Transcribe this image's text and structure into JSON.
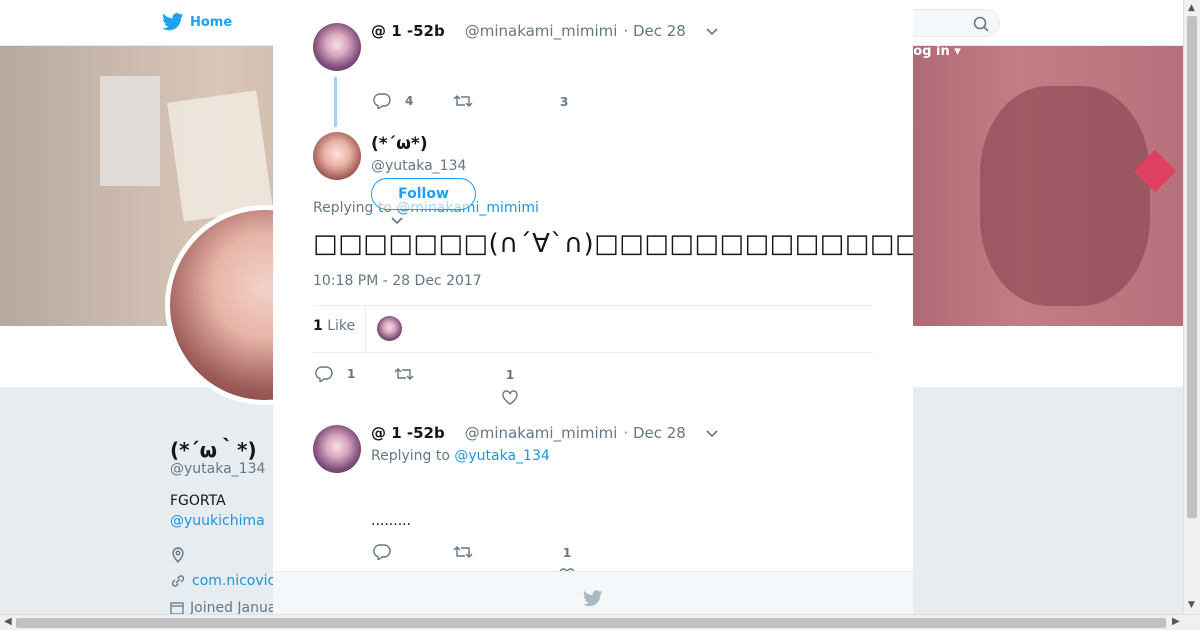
{
  "nav": {
    "home_label": "Home",
    "login_label": "Log in ▾"
  },
  "profile": {
    "name": "(*´ω｀*)",
    "handle": "@yutaka_134",
    "bio": "FGORTA",
    "bio_link": "@yuukichima",
    "url": "com.nicovic",
    "joined": "Joined Janua"
  },
  "tweet1": {
    "name": "@ 1 -52b",
    "handle": "@minakami_mimimi",
    "date": "· Dec 28",
    "replies": "4",
    "likes": "3"
  },
  "main_tweet": {
    "name": "(*´ω*)",
    "handle": "@yutaka_134",
    "follow_label": "Follow",
    "replying_prefix": "Replying to",
    "replying_to": "@minakami_mimimi",
    "text": "□□□□□□□(∩´∀`∩)□□□□□□□□□□□□□□□□□□□□□□□□□□□□□□□□□□□□□□□□□",
    "timestamp": "10:18 PM - 28 Dec 2017",
    "like_count": "1",
    "like_label": "Like",
    "replies": "1",
    "likes": "1"
  },
  "tweet3": {
    "name": "@ 1 -52b",
    "handle": "@minakami_mimimi",
    "date": "· Dec 28",
    "replying_prefix": "Replying to",
    "replying_to": "@yutaka_134",
    "text": ".........",
    "likes": "1"
  },
  "icons": [
    "twitter-bird-icon",
    "search-icon",
    "close-icon",
    "reply-icon",
    "retweet-icon",
    "heart-icon",
    "chevron-down-icon",
    "location-icon",
    "link-icon",
    "calendar-icon"
  ]
}
